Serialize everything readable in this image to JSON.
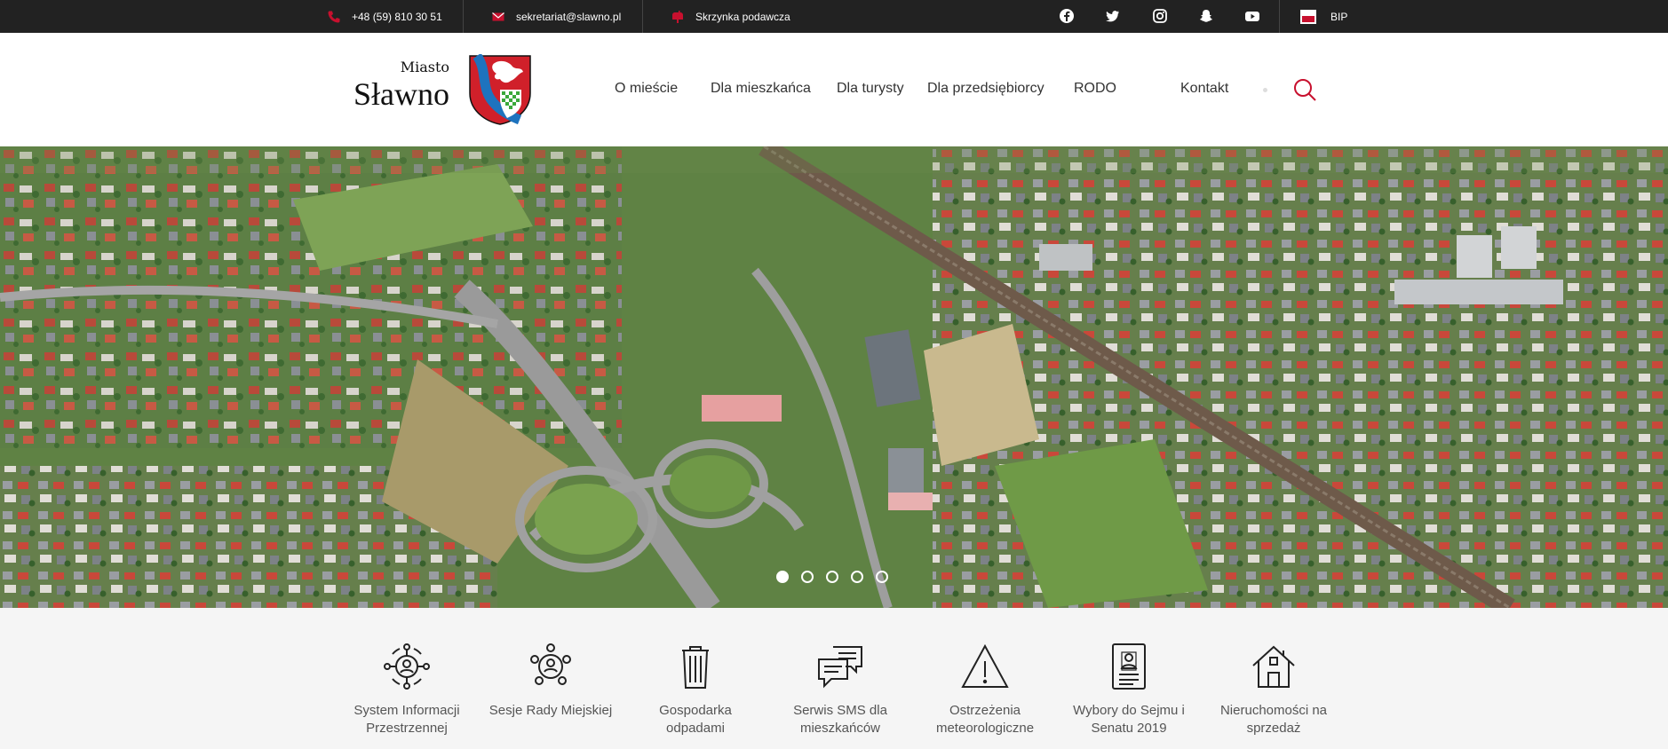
{
  "topbar": {
    "phone": "+48 (59) 810 30 51",
    "email": "sekretariat@slawno.pl",
    "mailbox": "Skrzynka podawcza",
    "socials": [
      "facebook-icon",
      "twitter-icon",
      "instagram-icon",
      "snapchat-icon",
      "youtube-icon"
    ],
    "bip": "BIP"
  },
  "header": {
    "logo_small": "Miasto",
    "logo_big": "Sławno",
    "nav": [
      "O mieście",
      "Dla mieszkańca",
      "Dla turysty",
      "Dla przedsiębiorcy",
      "RODO",
      "Kontakt"
    ]
  },
  "hero": {
    "slides": 5,
    "active_slide": 1
  },
  "quick_links": [
    {
      "label": "System Informacji Przestrzennej",
      "icon": "map-network-icon"
    },
    {
      "label": "Sesje Rady Miejskiej",
      "icon": "council-icon"
    },
    {
      "label": "Gospodarka odpadami",
      "icon": "trash-bin-icon"
    },
    {
      "label": "Serwis SMS dla mieszkańców",
      "icon": "sms-chat-icon"
    },
    {
      "label": "Ostrzeżenia meteorologiczne",
      "icon": "warning-icon"
    },
    {
      "label": "Wybory do Sejmu i Senatu 2019",
      "icon": "ballot-icon"
    },
    {
      "label": "Nieruchomości na sprzedaż",
      "icon": "house-icon"
    }
  ],
  "colors": {
    "accent": "#c8102e",
    "topbar_bg": "#222222",
    "nav_text": "#444444"
  }
}
